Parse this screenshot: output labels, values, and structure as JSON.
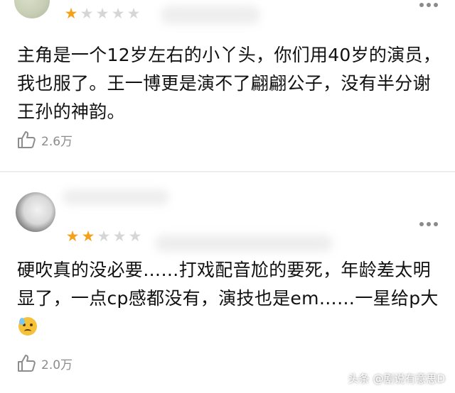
{
  "reviews": [
    {
      "stars_filled": 1,
      "stars_total": 5,
      "text": "主角是一个12岁左右的小丫头，你们用40岁的演员，我也服了。王一博更是演不了翩翩公子，没有半分谢王孙的神韵。",
      "likes": "2.6万"
    },
    {
      "stars_filled": 2,
      "stars_total": 5,
      "text": "硬吹真的没必要……打戏配音尬的要死，年龄差太明显了，一点cp感都没有，演技也是em……一星给p大",
      "likes": "2.0万"
    }
  ],
  "watermark": "头条 @剧说有意思D",
  "colors": {
    "star_on": "#f5a019",
    "star_off": "#d6d6d6",
    "meta_gray": "#8c8c8c"
  },
  "icons": {
    "like": "thumbs-up-icon",
    "more": "more-dots-icon",
    "star": "star-icon",
    "emoji": "sweat-face-emoji"
  }
}
